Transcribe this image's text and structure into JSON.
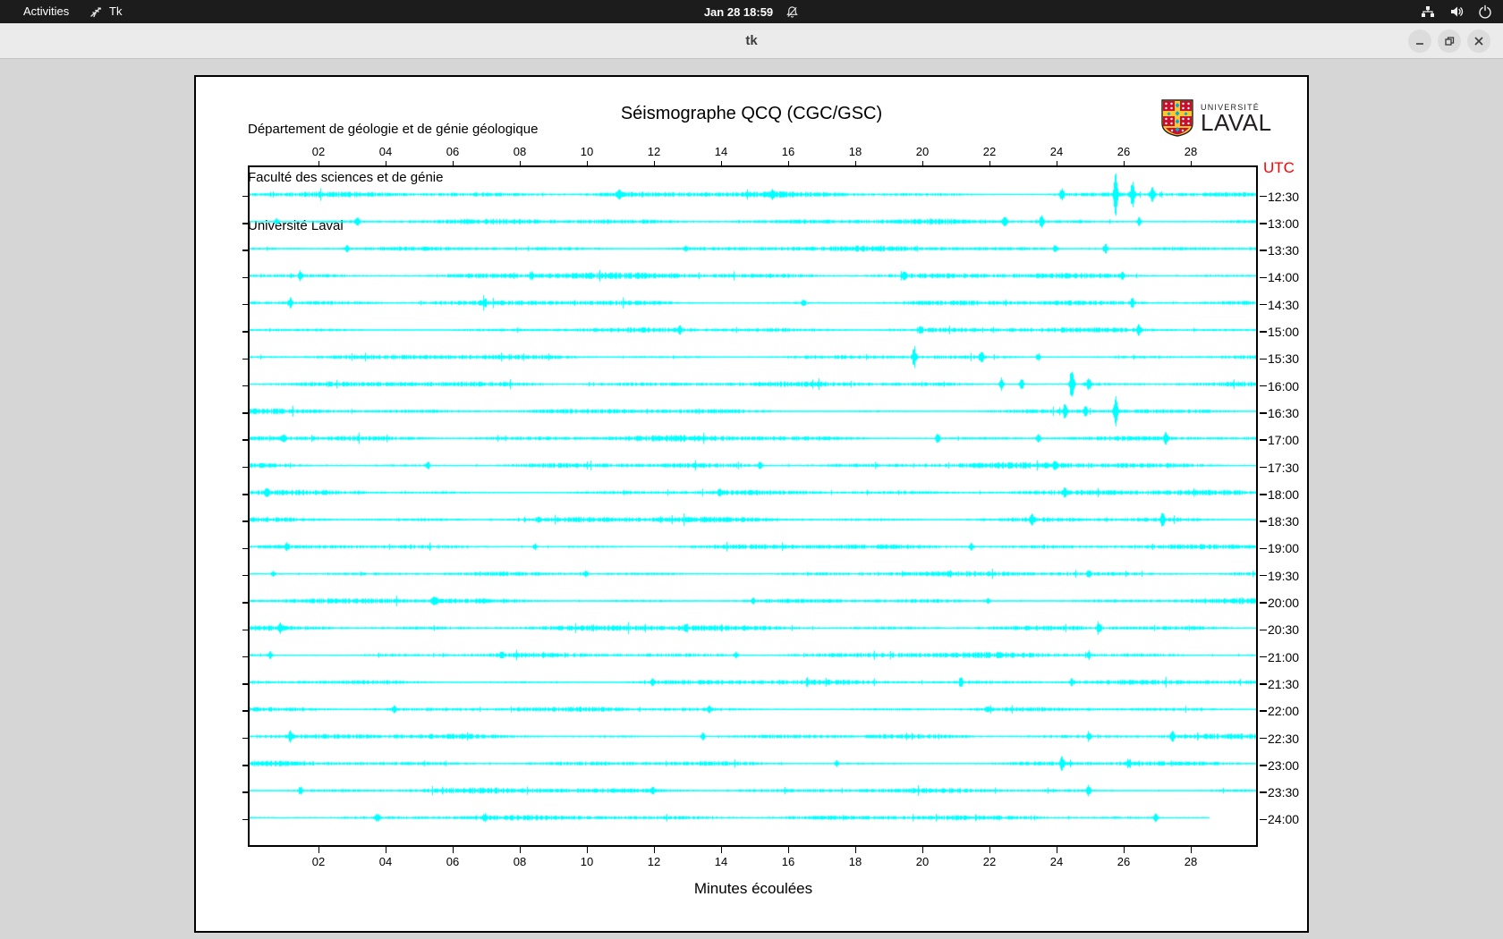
{
  "topbar": {
    "activities": "Activities",
    "app_name": "Tk",
    "clock": "Jan 28  18:59",
    "icons": [
      "tk-logo-icon",
      "notifications-muted-icon",
      "network-icon",
      "volume-icon",
      "power-icon"
    ]
  },
  "titlebar": {
    "title": "tk",
    "buttons": [
      "minimize",
      "maximize",
      "close"
    ]
  },
  "panel": {
    "address_lines": [
      "Département de géologie et de génie géologique",
      "Faculté des sciences et de génie",
      "Université Laval"
    ],
    "title": "Séismographe QCQ (CGC/GSC)",
    "logo": {
      "line1": "UNIVERSITÉ",
      "line2": "LAVAL"
    },
    "utc_label": "UTC",
    "xlabel": "Minutes écoulées"
  },
  "chart_data": {
    "type": "line",
    "title": "Séismographe QCQ (CGC/GSC)",
    "xlabel": "Minutes écoulées",
    "x_range_minutes": [
      0,
      30
    ],
    "x_ticks": [
      "02",
      "04",
      "06",
      "08",
      "10",
      "12",
      "14",
      "16",
      "18",
      "20",
      "22",
      "24",
      "26",
      "28"
    ],
    "trace_color": "#00ffff",
    "utc_label": "UTC",
    "traces": [
      {
        "label": "12:30",
        "base_amp": 1.5,
        "end_minute": 30,
        "events": [
          [
            11.0,
            5
          ],
          [
            15.6,
            5
          ],
          [
            24.2,
            7
          ],
          [
            25.8,
            24
          ],
          [
            26.3,
            15
          ],
          [
            26.9,
            9
          ]
        ]
      },
      {
        "label": "13:00",
        "base_amp": 1.4,
        "end_minute": 30,
        "events": [
          [
            0.8,
            5
          ],
          [
            3.2,
            5
          ],
          [
            22.5,
            6
          ],
          [
            23.6,
            7
          ],
          [
            26.5,
            6
          ]
        ]
      },
      {
        "label": "13:30",
        "base_amp": 1.3,
        "end_minute": 30,
        "events": [
          [
            2.9,
            4
          ],
          [
            13.0,
            4
          ],
          [
            24.0,
            5
          ],
          [
            25.5,
            7
          ]
        ]
      },
      {
        "label": "14:00",
        "base_amp": 1.6,
        "end_minute": 30,
        "events": [
          [
            1.5,
            5
          ],
          [
            8.4,
            5
          ],
          [
            19.5,
            4
          ],
          [
            26.0,
            5
          ]
        ]
      },
      {
        "label": "14:30",
        "base_amp": 1.5,
        "end_minute": 30,
        "events": [
          [
            1.2,
            6
          ],
          [
            7.0,
            4
          ],
          [
            16.5,
            4
          ],
          [
            26.3,
            6
          ]
        ]
      },
      {
        "label": "15:00",
        "base_amp": 1.3,
        "end_minute": 30,
        "events": [
          [
            12.8,
            4
          ],
          [
            20.0,
            4
          ],
          [
            26.5,
            7
          ]
        ]
      },
      {
        "label": "15:30",
        "base_amp": 1.3,
        "end_minute": 30,
        "events": [
          [
            19.8,
            12
          ],
          [
            21.8,
            9
          ],
          [
            23.5,
            5
          ]
        ]
      },
      {
        "label": "16:00",
        "base_amp": 1.4,
        "end_minute": 30,
        "events": [
          [
            22.4,
            9
          ],
          [
            23.0,
            7
          ],
          [
            24.5,
            26
          ],
          [
            25.0,
            8
          ]
        ]
      },
      {
        "label": "16:30",
        "base_amp": 1.3,
        "end_minute": 30,
        "events": [
          [
            24.3,
            9
          ],
          [
            24.9,
            7
          ],
          [
            25.8,
            16
          ]
        ]
      },
      {
        "label": "17:00",
        "base_amp": 1.5,
        "end_minute": 30,
        "events": [
          [
            1.0,
            5
          ],
          [
            20.5,
            6
          ],
          [
            23.5,
            5
          ],
          [
            27.3,
            7
          ]
        ]
      },
      {
        "label": "17:30",
        "base_amp": 1.5,
        "end_minute": 30,
        "events": [
          [
            5.3,
            5
          ],
          [
            15.2,
            4
          ],
          [
            24.0,
            5
          ]
        ]
      },
      {
        "label": "18:00",
        "base_amp": 1.4,
        "end_minute": 30,
        "events": [
          [
            0.5,
            5
          ],
          [
            14.0,
            4
          ],
          [
            24.3,
            5
          ]
        ]
      },
      {
        "label": "18:30",
        "base_amp": 1.4,
        "end_minute": 30,
        "events": [
          [
            8.6,
            4
          ],
          [
            23.3,
            6
          ],
          [
            27.2,
            8
          ]
        ]
      },
      {
        "label": "19:00",
        "base_amp": 1.3,
        "end_minute": 30,
        "events": [
          [
            1.1,
            4
          ],
          [
            8.5,
            4
          ],
          [
            21.5,
            4
          ]
        ]
      },
      {
        "label": "19:30",
        "base_amp": 1.3,
        "end_minute": 30,
        "events": [
          [
            0.7,
            4
          ],
          [
            10.0,
            4
          ],
          [
            25.0,
            4
          ]
        ]
      },
      {
        "label": "20:00",
        "base_amp": 1.4,
        "end_minute": 30,
        "events": [
          [
            5.5,
            4
          ],
          [
            15.0,
            4
          ],
          [
            22.0,
            4
          ]
        ]
      },
      {
        "label": "20:30",
        "base_amp": 1.5,
        "end_minute": 30,
        "events": [
          [
            0.9,
            5
          ],
          [
            13.0,
            4
          ],
          [
            25.3,
            6
          ]
        ]
      },
      {
        "label": "21:00",
        "base_amp": 1.4,
        "end_minute": 30,
        "events": [
          [
            0.6,
            5
          ],
          [
            7.5,
            4
          ],
          [
            14.5,
            4
          ],
          [
            25.0,
            5
          ]
        ]
      },
      {
        "label": "21:30",
        "base_amp": 1.3,
        "end_minute": 30,
        "events": [
          [
            12.0,
            4
          ],
          [
            21.2,
            6
          ],
          [
            24.5,
            4
          ]
        ]
      },
      {
        "label": "22:00",
        "base_amp": 1.3,
        "end_minute": 30,
        "events": [
          [
            4.3,
            4
          ],
          [
            13.7,
            4
          ],
          [
            22.0,
            4
          ]
        ]
      },
      {
        "label": "22:30",
        "base_amp": 1.4,
        "end_minute": 30,
        "events": [
          [
            1.2,
            6
          ],
          [
            13.5,
            5
          ],
          [
            25.0,
            5
          ],
          [
            27.5,
            5
          ]
        ]
      },
      {
        "label": "23:00",
        "base_amp": 1.3,
        "end_minute": 30,
        "events": [
          [
            17.5,
            4
          ],
          [
            24.2,
            7
          ],
          [
            26.2,
            6
          ]
        ]
      },
      {
        "label": "23:30",
        "base_amp": 1.4,
        "end_minute": 30,
        "events": [
          [
            1.5,
            5
          ],
          [
            12.0,
            4
          ],
          [
            25.0,
            6
          ]
        ]
      },
      {
        "label": "24:00",
        "base_amp": 1.3,
        "end_minute": 28.6,
        "events": [
          [
            3.8,
            5
          ],
          [
            7.0,
            4
          ],
          [
            27.0,
            6
          ]
        ]
      }
    ]
  }
}
